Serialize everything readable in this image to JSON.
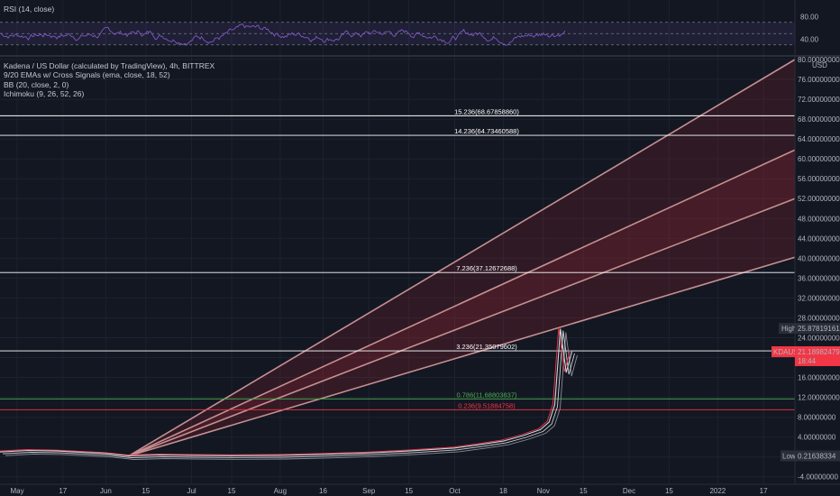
{
  "rsi": {
    "label": "RSI (14, close)",
    "ticks": [
      {
        "label": "80.00",
        "value": 80
      },
      {
        "label": "40.00",
        "value": 40
      }
    ],
    "color": "#7e57c2"
  },
  "legend": {
    "title": "Kadena / US Dollar (calculated by TradingView), 4h, BITTREX",
    "ind1": "9/20 EMAs w/ Cross Signals (ema, close, 18, 52)",
    "ind2": "BB (20, close, 2, 0)",
    "ind3": "Ichimoku (9, 26, 52, 26)"
  },
  "price_scale": {
    "currency": "USD"
  },
  "markers": {
    "high_label": "High",
    "high_value": "25.87819161",
    "symbol": "KDAUSD",
    "last_price": "21.18982479",
    "countdown": "18:44",
    "low_label": "Low",
    "low_value": "0.21638334"
  },
  "colors": {
    "background": "#131722",
    "fib": "#ffffff",
    "fib_red": "#f23645",
    "fib_green": "#4caf50",
    "fan": "#c58f91",
    "symbol_bg": "#f23645",
    "candle": "#d1d4dc"
  },
  "chart_data": {
    "type": "line",
    "title": "Kadena / US Dollar (calculated by TradingView), 4h, BITTREX",
    "ylim": [
      -5.5,
      80
    ],
    "yticks": [
      -4,
      0,
      4,
      8,
      12,
      16,
      20,
      24,
      28,
      32,
      36,
      40,
      44,
      48,
      52,
      56,
      60,
      64,
      68,
      72,
      76,
      80
    ],
    "ytick_labels": [
      "-4.00000000",
      "0.00000000",
      "4.00000000",
      "8.00000000",
      "12.00000000",
      "16.00000000",
      "20.00000000",
      "24.00000000",
      "28.00000000",
      "32.00000000",
      "36.00000000",
      "40.00000000",
      "44.00000000",
      "48.00000000",
      "52.00000000",
      "56.00000000",
      "60.00000000",
      "64.00000000",
      "68.00000000",
      "72.00000000",
      "76.00000000",
      "80.00000000"
    ],
    "xlim": [
      "2021-04-25",
      "2022-01-28"
    ],
    "xticks": [
      {
        "label": "May",
        "date": "2021-05-01"
      },
      {
        "label": "17",
        "date": "2021-05-17"
      },
      {
        "label": "Jun",
        "date": "2021-06-01"
      },
      {
        "label": "15",
        "date": "2021-06-15"
      },
      {
        "label": "Jul",
        "date": "2021-07-01"
      },
      {
        "label": "15",
        "date": "2021-07-15"
      },
      {
        "label": "Aug",
        "date": "2021-08-01"
      },
      {
        "label": "16",
        "date": "2021-08-16"
      },
      {
        "label": "Sep",
        "date": "2021-09-01"
      },
      {
        "label": "15",
        "date": "2021-09-15"
      },
      {
        "label": "Oct",
        "date": "2021-10-01"
      },
      {
        "label": "18",
        "date": "2021-10-18"
      },
      {
        "label": "Nov",
        "date": "2021-11-01"
      },
      {
        "label": "15",
        "date": "2021-11-15"
      },
      {
        "label": "Dec",
        "date": "2021-12-01"
      },
      {
        "label": "15",
        "date": "2021-12-15"
      },
      {
        "label": "2022",
        "date": "2022-01-01"
      },
      {
        "label": "17",
        "date": "2022-01-17"
      }
    ],
    "fib_levels": [
      {
        "label": "15.236(68.67858860)",
        "value": 68.6785886,
        "color": "#ffffff"
      },
      {
        "label": "14.236(64.73460588)",
        "value": 64.73460588,
        "color": "#ffffff"
      },
      {
        "label": "7.236(37.12672688)",
        "value": 37.12672688,
        "color": "#ffffff"
      },
      {
        "label": "3.236(21.35079602)",
        "value": 21.35079602,
        "color": "#ffffff"
      },
      {
        "label": "0.786(11.68803837)",
        "value": 11.68803837,
        "color": "#4caf50"
      },
      {
        "label": "0.236(9.51884758)",
        "value": 9.51884758,
        "color": "#f23645"
      }
    ],
    "fan": {
      "origin": {
        "date": "2021-06-09",
        "value": 0.2
      },
      "lines": [
        {
          "date": "2022-01-28",
          "value": 80.0
        },
        {
          "date": "2022-01-28",
          "value": 61.8
        },
        {
          "date": "2022-01-28",
          "value": 52.0
        },
        {
          "date": "2022-01-28",
          "value": 40.2
        }
      ]
    },
    "series": [
      {
        "name": "KDAUSD",
        "color": "#d1d4dc",
        "x": [
          "2021-04-25",
          "2021-05-05",
          "2021-05-15",
          "2021-05-25",
          "2021-06-01",
          "2021-06-09",
          "2021-06-20",
          "2021-07-01",
          "2021-07-15",
          "2021-08-01",
          "2021-08-15",
          "2021-09-01",
          "2021-09-15",
          "2021-10-01",
          "2021-10-10",
          "2021-10-18",
          "2021-10-25",
          "2021-10-31",
          "2021-11-03",
          "2021-11-05",
          "2021-11-07",
          "2021-11-09",
          "2021-11-11"
        ],
        "y": [
          1.0,
          1.3,
          1.2,
          0.9,
          0.7,
          0.22,
          0.4,
          0.3,
          0.25,
          0.3,
          0.5,
          0.8,
          1.2,
          1.8,
          2.5,
          3.2,
          4.3,
          5.5,
          7.0,
          10.5,
          25.8,
          17.0,
          21.2
        ]
      }
    ],
    "rsi_ylim": [
      20,
      100
    ]
  }
}
